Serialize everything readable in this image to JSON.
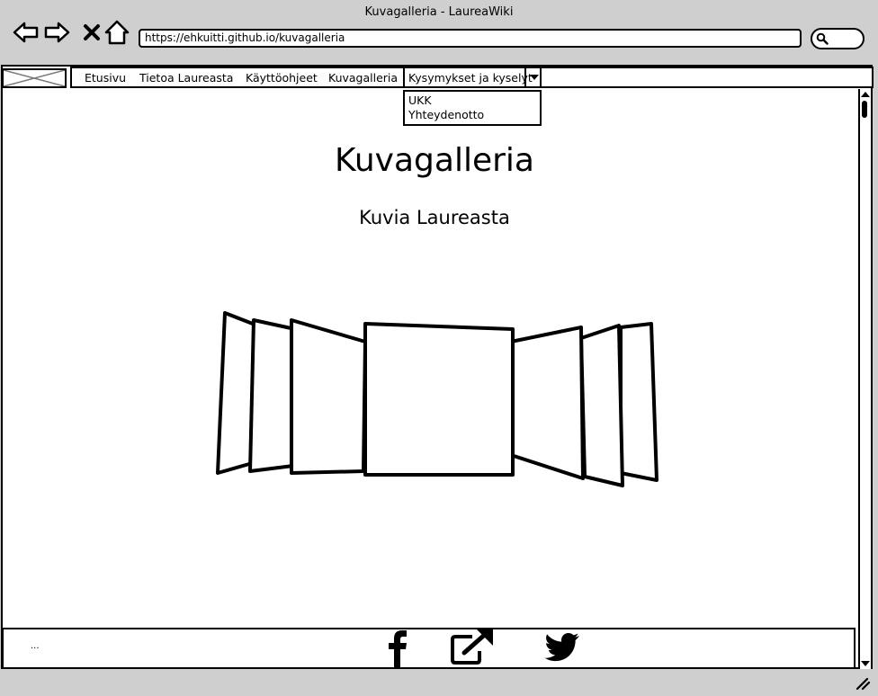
{
  "window": {
    "title": "Kuvagalleria - LaureaWiki"
  },
  "browser": {
    "url": "https://ehkuitti.github.io/kuvagalleria",
    "icons": [
      "back-arrow-icon",
      "forward-arrow-icon",
      "close-icon",
      "home-icon",
      "search-icon"
    ]
  },
  "nav": {
    "items": [
      {
        "label": "Etusivu"
      },
      {
        "label": "Tietoa Laureasta"
      },
      {
        "label": "Käyttöohjeet"
      },
      {
        "label": "Kuvagalleria"
      }
    ],
    "dropdown": {
      "label": "Kysymykset ja kyselyt",
      "options": [
        {
          "label": "UKK"
        },
        {
          "label": "Yhteydenotto"
        }
      ]
    }
  },
  "main": {
    "title": "Kuvagalleria",
    "subtitle": "Kuvia Laureasta",
    "carousel_icon": "image-carousel-icon"
  },
  "footer": {
    "text": "...",
    "social_icons": [
      "facebook-icon",
      "external-link-icon",
      "twitter-icon"
    ]
  },
  "colors": {
    "chrome": "#cfcfcf",
    "background": "#ffffff",
    "ink": "#000000"
  }
}
